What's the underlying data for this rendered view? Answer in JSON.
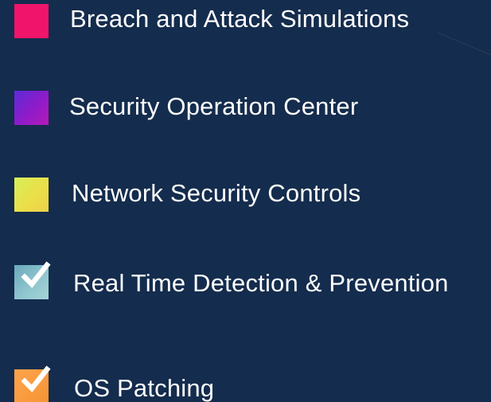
{
  "legend": {
    "items": [
      {
        "label": "Breach and Attack Simulations",
        "color": "#f0146a",
        "icon": "pink-square-icon"
      },
      {
        "label": "Security Operation Center",
        "color": "#8f1bc9",
        "icon": "purple-gradient-square-icon"
      },
      {
        "label": "Network Security Controls",
        "color": "#eadf49",
        "icon": "yellow-gradient-square-icon"
      },
      {
        "label": "Real Time Detection & Prevention",
        "color": "#92c7cf",
        "icon": "teal-checkbox-checked-icon",
        "checked": true
      },
      {
        "label": "OS Patching",
        "color": "#ffa44c",
        "icon": "orange-checkbox-checked-icon",
        "checked": true
      }
    ]
  },
  "theme": {
    "background": "#142c4d",
    "text": "#ffffff"
  }
}
